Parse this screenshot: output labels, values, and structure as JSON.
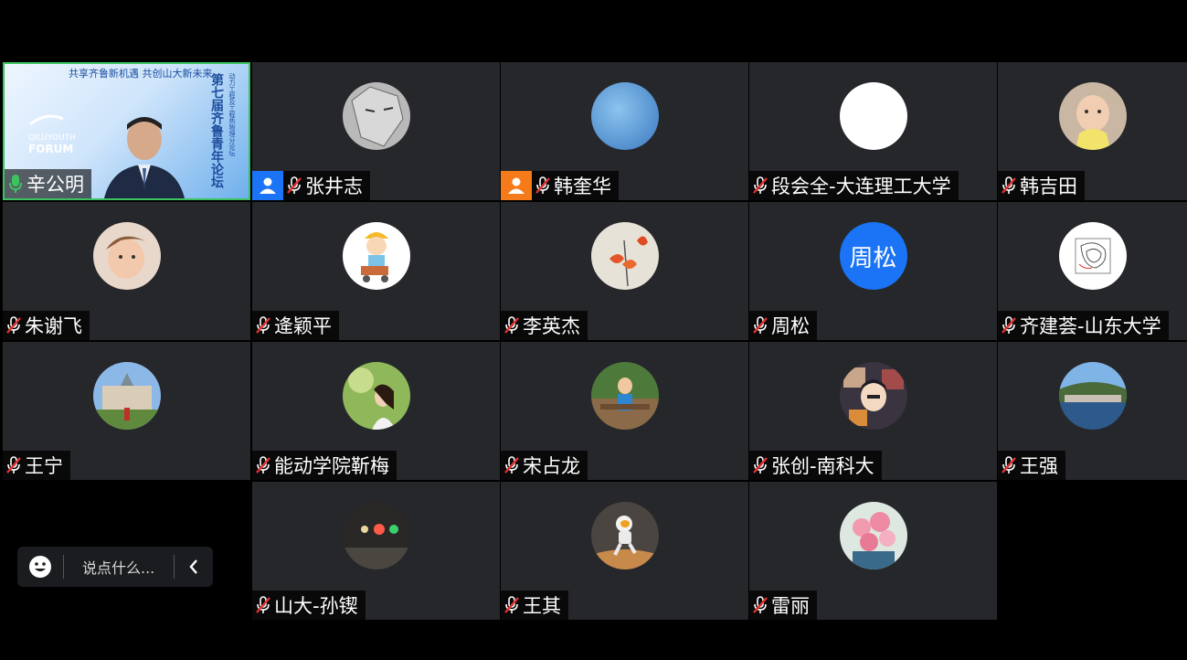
{
  "participants": [
    {
      "name": "辛公明",
      "mic": "on",
      "role": null,
      "speaking": true
    },
    {
      "name": "张井志",
      "mic": "off",
      "role": "host",
      "avatar": "sketch-portrait"
    },
    {
      "name": "韩奎华",
      "mic": "off",
      "role": "cohost",
      "avatar": "blue-sky"
    },
    {
      "name": "段会全-大连理工大学",
      "mic": "off",
      "role": null,
      "avatar": "white-blank"
    },
    {
      "name": "韩吉田",
      "mic": "off",
      "role": null,
      "avatar": "baby-photo"
    },
    {
      "name": "朱谢飞",
      "mic": "off",
      "role": null,
      "avatar": "child-photo"
    },
    {
      "name": "逄颖平",
      "mic": "off",
      "role": null,
      "avatar": "cartoon-worker"
    },
    {
      "name": "李英杰",
      "mic": "off",
      "role": null,
      "avatar": "flower-painting"
    },
    {
      "name": "周松",
      "mic": "off",
      "role": null,
      "avatar_text": "周松"
    },
    {
      "name": "齐建荟-山东大学",
      "mic": "off",
      "role": null,
      "avatar": "contour-plot"
    },
    {
      "name": "王宁",
      "mic": "off",
      "role": null,
      "avatar": "building-photo"
    },
    {
      "name": "能动学院靳梅",
      "mic": "off",
      "role": null,
      "avatar": "woman-garden"
    },
    {
      "name": "宋占龙",
      "mic": "off",
      "role": null,
      "avatar": "child-outdoor"
    },
    {
      "name": "张创-南科大",
      "mic": "off",
      "role": null,
      "avatar": "anime-collage"
    },
    {
      "name": "王强",
      "mic": "off",
      "role": null,
      "avatar": "harbor-town"
    },
    {
      "name": "山大-孙锲",
      "mic": "off",
      "role": null,
      "avatar": "night-lights"
    },
    {
      "name": "王其",
      "mic": "off",
      "role": null,
      "avatar": "astronaut"
    },
    {
      "name": "雷丽",
      "mic": "off",
      "role": null,
      "avatar": "flower-bouquet"
    }
  ],
  "speaker_slide": {
    "slogan": "共享齐鲁新机遇  共创山大新未来",
    "title": "第七届齐鲁青年论坛",
    "subtitle": "动力工程及工程热物理分论坛",
    "logo_line1": "QILUYOUTH",
    "logo_line2": "FORUM"
  },
  "chat": {
    "placeholder": "说点什么..."
  },
  "colors": {
    "host_badge": "#1a74f5",
    "cohost_badge": "#f57b1a",
    "active_mic": "#3cc35f",
    "muted_mic": "#e2322f"
  }
}
